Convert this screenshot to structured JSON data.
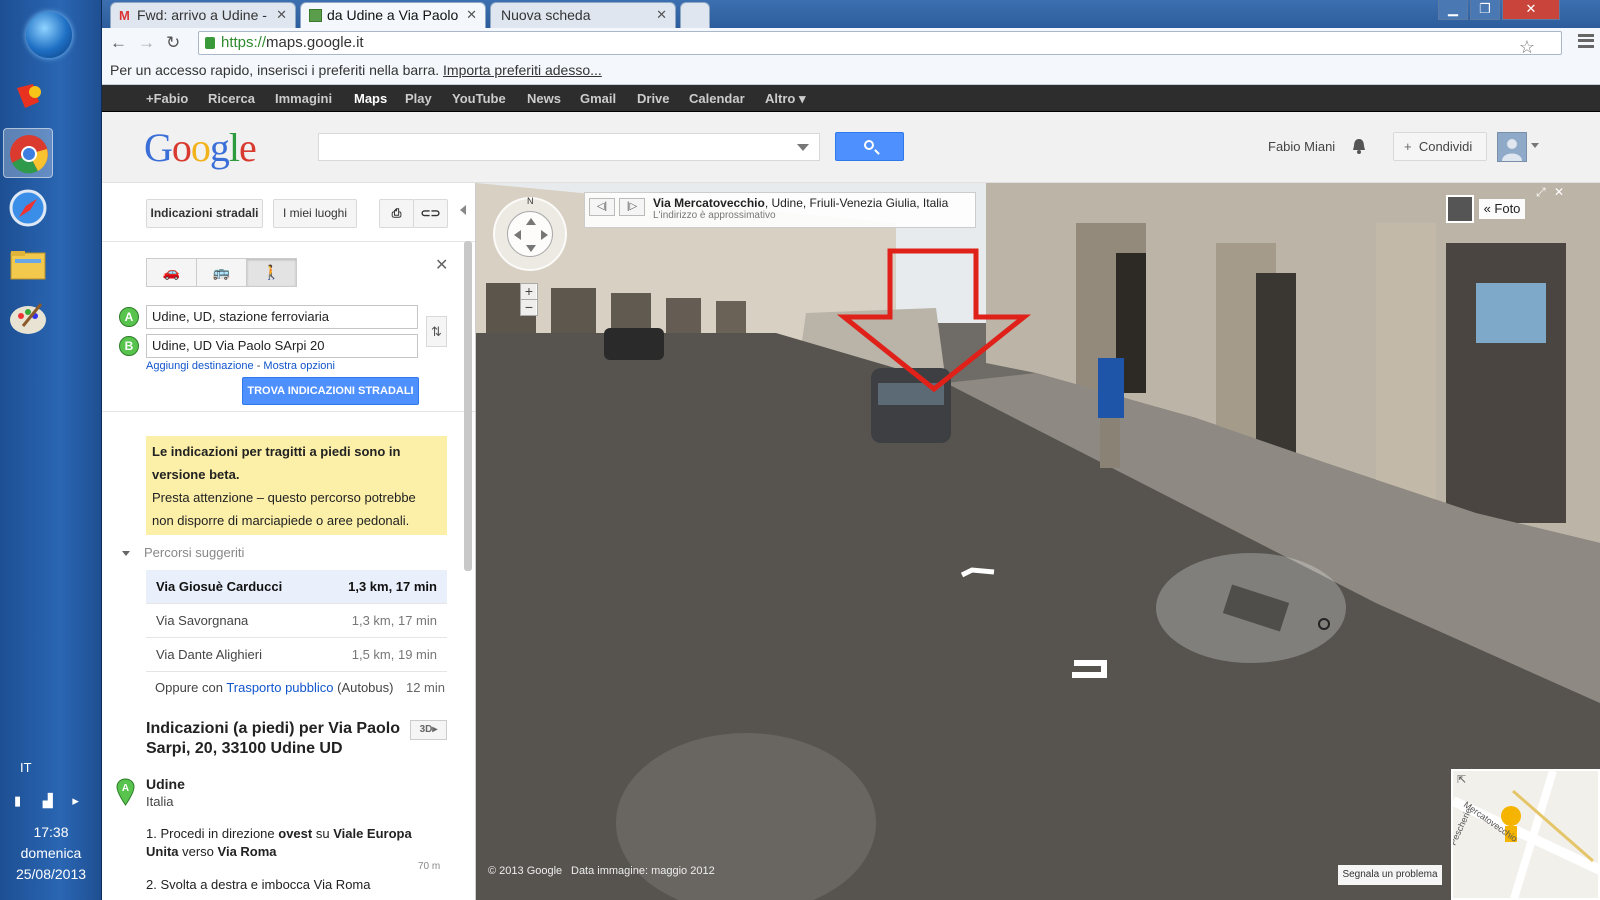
{
  "taskbar": {
    "lang": "IT",
    "time": "17:38",
    "day": "domenica",
    "date": "25/08/2013"
  },
  "browser": {
    "tabs": [
      {
        "title": "Fwd: arrivo a Udine -",
        "icon": "gmail-icon"
      },
      {
        "title": "da Udine a Via Paolo",
        "icon": "maps-icon"
      },
      {
        "title": "Nuova scheda",
        "icon": ""
      }
    ],
    "url_scheme": "https://",
    "url_host": "maps.google.it",
    "bookmark_hint": "Per un accesso rapido, inserisci i preferiti nella barra.",
    "bookmark_link": "Importa preferiti adesso..."
  },
  "gbar": [
    "+Fabio",
    "Ricerca",
    "Immagini",
    "Maps",
    "Play",
    "YouTube",
    "News",
    "Gmail",
    "Drive",
    "Calendar",
    "Altro"
  ],
  "header": {
    "logo": "Google",
    "user": "Fabio Miani",
    "share": "Condividi"
  },
  "panel": {
    "btn_directions": "Indicazioni stradali",
    "btn_places": "I miei luoghi",
    "origin": "Udine, UD, stazione ferroviaria",
    "destination": "Udine, UD Via Paolo SArpi 20",
    "marker_a": "A",
    "marker_b": "B",
    "add_dest": "Aggiungi destinazione",
    "options_sep": " - ",
    "show_opts": "Mostra opzioni",
    "find_btn": "TROVA INDICAZIONI STRADALI",
    "beta_title": "Le indicazioni per tragitti a piedi sono in versione beta.",
    "beta_body": "Presta attenzione – questo percorso potrebbe non disporre di marciapiede o aree pedonali.",
    "routes_head": "Percorsi suggeriti",
    "routes": [
      {
        "name": "Via Giosuè Carducci",
        "detail": "1,3 km, 17 min"
      },
      {
        "name": "Via Savorgnana",
        "detail": "1,3 km, 17 min"
      },
      {
        "name": "Via Dante Alighieri",
        "detail": "1,5 km, 19 min"
      }
    ],
    "transit_prefix": "Oppure con ",
    "transit_link": "Trasporto pubblico",
    "transit_mode": " (Autobus)",
    "transit_time": "12 min",
    "dir_title": "Indicazioni (a piedi) per Via Paolo Sarpi, 20, 33100 Udine UD",
    "btn_3d": "3D",
    "start_name": "Udine",
    "start_sub": "Italia",
    "step1_num": "1.",
    "step1_a": " Procedi in direzione ",
    "step1_dir": "ovest",
    "step1_b": " su ",
    "step1_street": "Viale Europa Unita",
    "step1_c": " verso ",
    "step1_to": "Via Roma",
    "step1_dist": "70 m",
    "step2": "2. Svolta a destra e imbocca Via Roma"
  },
  "streetview": {
    "street": "Via Mercatovecchio",
    "locality": ", Udine, Friuli-Venezia Giulia, Italia",
    "approx": "L'indirizzo è approssimativo",
    "foto": "« Foto",
    "copyright": "© 2013 Google",
    "imgdate": "Data immagine: maggio 2012",
    "report": "Segnala un problema",
    "compass_n": "N",
    "minimap_street1": "Mercatovecchio",
    "minimap_street2": "Pescherie"
  }
}
